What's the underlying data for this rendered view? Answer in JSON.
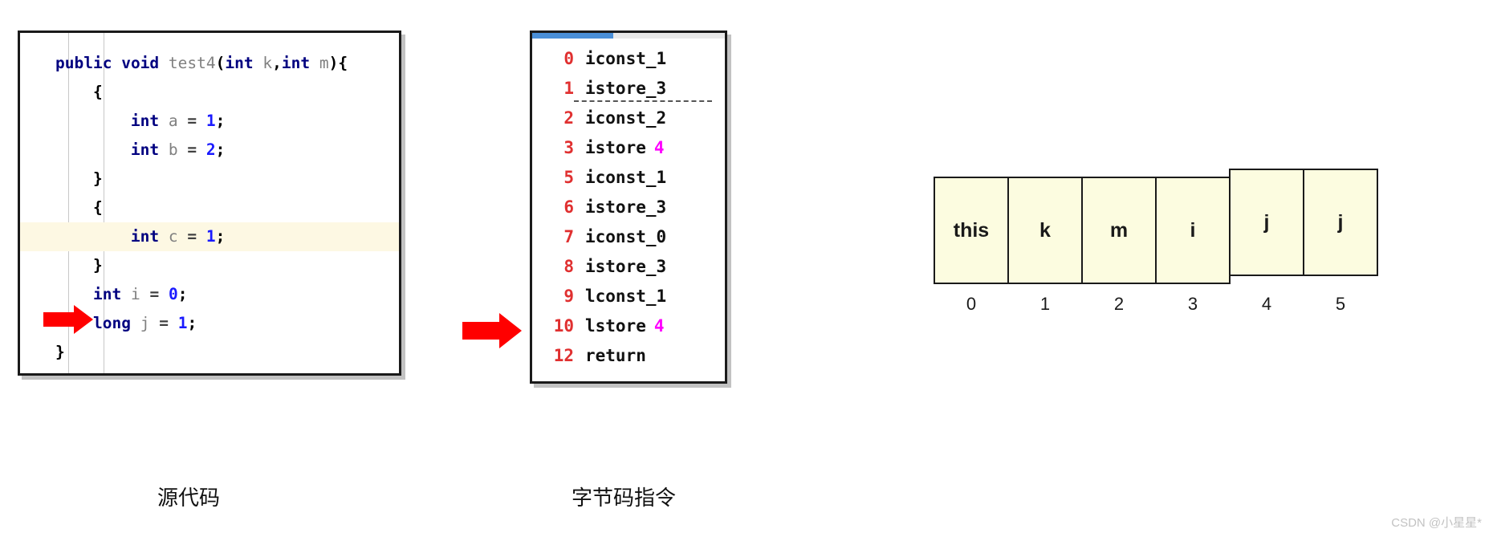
{
  "source_panel": {
    "name": "source-code-panel",
    "lines": [
      {
        "indent": 0,
        "highlight": false,
        "tokens": [
          {
            "t": "public",
            "c": "kw"
          },
          {
            "t": " ",
            "c": "pl"
          },
          {
            "t": "void",
            "c": "kw"
          },
          {
            "t": " ",
            "c": "pl"
          },
          {
            "t": "test4",
            "c": "id"
          },
          {
            "t": "(",
            "c": "pl"
          },
          {
            "t": "int",
            "c": "kw"
          },
          {
            "t": " ",
            "c": "pl"
          },
          {
            "t": "k",
            "c": "id"
          },
          {
            "t": ",",
            "c": "pl"
          },
          {
            "t": "int",
            "c": "kw"
          },
          {
            "t": " ",
            "c": "pl"
          },
          {
            "t": "m",
            "c": "id"
          },
          {
            "t": "){",
            "c": "pl"
          }
        ]
      },
      {
        "indent": 1,
        "highlight": false,
        "tokens": [
          {
            "t": "{",
            "c": "pl"
          }
        ]
      },
      {
        "indent": 2,
        "highlight": false,
        "tokens": [
          {
            "t": "int",
            "c": "kw"
          },
          {
            "t": " ",
            "c": "pl"
          },
          {
            "t": "a",
            "c": "id"
          },
          {
            "t": " ",
            "c": "pl"
          },
          {
            "t": "=",
            "c": "op"
          },
          {
            "t": " ",
            "c": "pl"
          },
          {
            "t": "1",
            "c": "num"
          },
          {
            "t": ";",
            "c": "pl"
          }
        ]
      },
      {
        "indent": 2,
        "highlight": false,
        "tokens": [
          {
            "t": "int",
            "c": "kw"
          },
          {
            "t": " ",
            "c": "pl"
          },
          {
            "t": "b",
            "c": "id"
          },
          {
            "t": " ",
            "c": "pl"
          },
          {
            "t": "=",
            "c": "op"
          },
          {
            "t": " ",
            "c": "pl"
          },
          {
            "t": "2",
            "c": "num"
          },
          {
            "t": ";",
            "c": "pl"
          }
        ]
      },
      {
        "indent": 1,
        "highlight": false,
        "tokens": [
          {
            "t": "}",
            "c": "pl"
          }
        ]
      },
      {
        "indent": 1,
        "highlight": false,
        "tokens": [
          {
            "t": "{",
            "c": "pl"
          }
        ]
      },
      {
        "indent": 2,
        "highlight": true,
        "tokens": [
          {
            "t": "int",
            "c": "kw"
          },
          {
            "t": " ",
            "c": "pl"
          },
          {
            "t": "c",
            "c": "id"
          },
          {
            "t": " ",
            "c": "pl"
          },
          {
            "t": "=",
            "c": "op"
          },
          {
            "t": " ",
            "c": "pl"
          },
          {
            "t": "1",
            "c": "num"
          },
          {
            "t": ";",
            "c": "pl"
          }
        ]
      },
      {
        "indent": 1,
        "highlight": false,
        "tokens": [
          {
            "t": "}",
            "c": "pl"
          }
        ]
      },
      {
        "indent": 1,
        "highlight": false,
        "tokens": [
          {
            "t": "int",
            "c": "kw"
          },
          {
            "t": " ",
            "c": "pl"
          },
          {
            "t": "i",
            "c": "id"
          },
          {
            "t": " ",
            "c": "pl"
          },
          {
            "t": "=",
            "c": "op"
          },
          {
            "t": " ",
            "c": "pl"
          },
          {
            "t": "0",
            "c": "num"
          },
          {
            "t": ";",
            "c": "pl"
          }
        ]
      },
      {
        "indent": 1,
        "highlight": false,
        "tokens": [
          {
            "t": "long",
            "c": "kw"
          },
          {
            "t": " ",
            "c": "pl"
          },
          {
            "t": "j",
            "c": "id"
          },
          {
            "t": " ",
            "c": "pl"
          },
          {
            "t": "=",
            "c": "op"
          },
          {
            "t": " ",
            "c": "pl"
          },
          {
            "t": "1",
            "c": "num"
          },
          {
            "t": ";",
            "c": "pl"
          }
        ]
      },
      {
        "indent": 0,
        "highlight": false,
        "tokens": [
          {
            "t": "}",
            "c": "pl"
          }
        ]
      }
    ]
  },
  "bytecode_panel": {
    "name": "bytecode-instruction-panel",
    "scroll_fraction": 42,
    "instructions": [
      {
        "index": "0",
        "mnemonic": "iconst_1",
        "arg": "",
        "dashed": false
      },
      {
        "index": "1",
        "mnemonic": "istore_3",
        "arg": "",
        "dashed": true
      },
      {
        "index": "2",
        "mnemonic": "iconst_2",
        "arg": "",
        "dashed": false
      },
      {
        "index": "3",
        "mnemonic": "istore",
        "arg": "4",
        "dashed": false
      },
      {
        "index": "5",
        "mnemonic": "iconst_1",
        "arg": "",
        "dashed": false
      },
      {
        "index": "6",
        "mnemonic": "istore_3",
        "arg": "",
        "dashed": false
      },
      {
        "index": "7",
        "mnemonic": "iconst_0",
        "arg": "",
        "dashed": false
      },
      {
        "index": "8",
        "mnemonic": "istore_3",
        "arg": "",
        "dashed": false
      },
      {
        "index": "9",
        "mnemonic": "lconst_1",
        "arg": "",
        "dashed": false
      },
      {
        "index": "10",
        "mnemonic": "lstore",
        "arg": "4",
        "dashed": false
      },
      {
        "index": "12",
        "mnemonic": "return",
        "arg": "",
        "dashed": false
      }
    ]
  },
  "slot_table": {
    "name": "local-variable-slot-table",
    "slots": [
      {
        "label": "this",
        "index": "0",
        "raised": false
      },
      {
        "label": "k",
        "index": "1",
        "raised": false
      },
      {
        "label": "m",
        "index": "2",
        "raised": false
      },
      {
        "label": "i",
        "index": "3",
        "raised": false
      },
      {
        "label": "j",
        "index": "4",
        "raised": true
      },
      {
        "label": "j",
        "index": "5",
        "raised": true
      }
    ]
  },
  "captions": {
    "source": "源代码",
    "bytecode": "字节码指令"
  },
  "watermark": "CSDN @小星星*",
  "colors": {
    "keyword": "#000080",
    "identifier": "#808080",
    "number": "#1a1aff",
    "bytecode_index": "#e03030",
    "bytecode_arg": "#ff00ff",
    "arrow": "#ff0000",
    "scrollbar": "#4a8fd8",
    "slot_fill": "#fcfce0",
    "highlight_line": "#fdf8e3"
  }
}
